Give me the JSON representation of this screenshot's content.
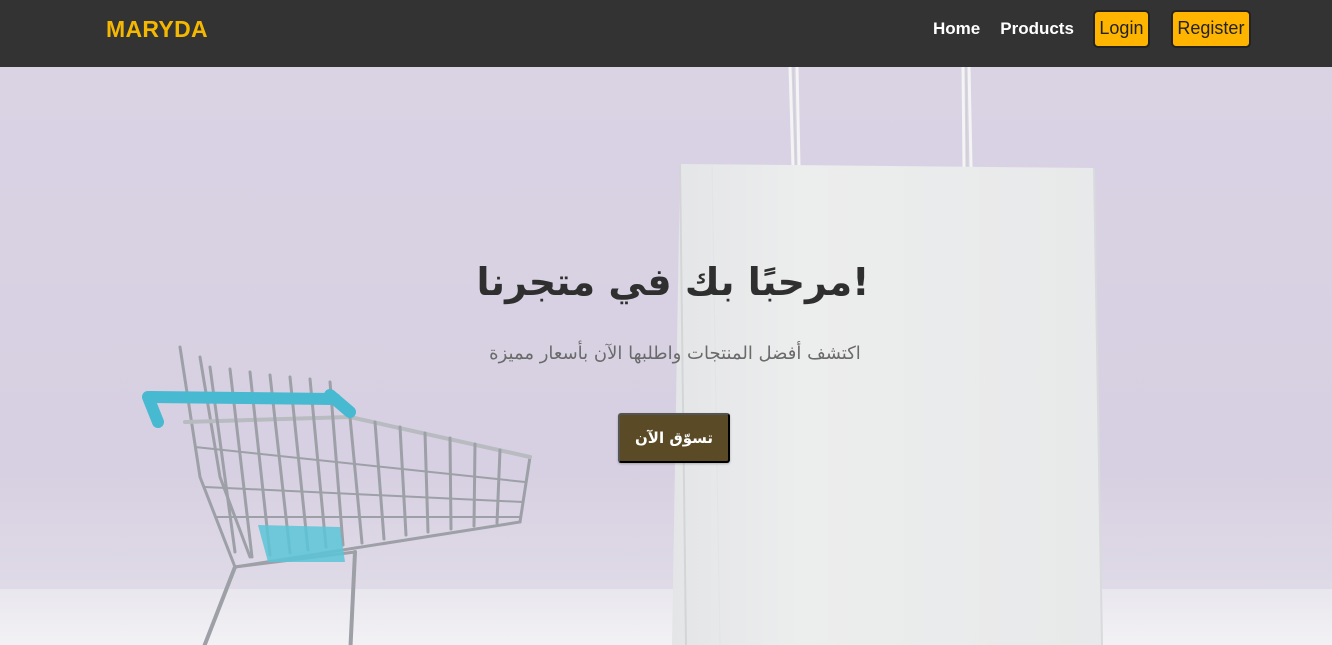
{
  "navbar": {
    "brand": "MARYDA",
    "links": {
      "home": "Home",
      "products": "Products"
    },
    "buttons": {
      "login": "Login",
      "register": "Register"
    },
    "brand_color": "#f5b800",
    "button_color": "#ffb400",
    "background": "#333333"
  },
  "hero": {
    "title": "!مرحبًا بك في متجرنا",
    "subtitle": "اكتشف أفضل المنتجات واطلبها الآن بأسعار مميزة",
    "cta_label": "تسوّق الآن",
    "cta_color": "#5a4a26",
    "background_image": "shopping-cart-and-paper-bag"
  },
  "icons": {
    "cart": "shopping-cart-icon",
    "bag": "shopping-bag-icon"
  }
}
